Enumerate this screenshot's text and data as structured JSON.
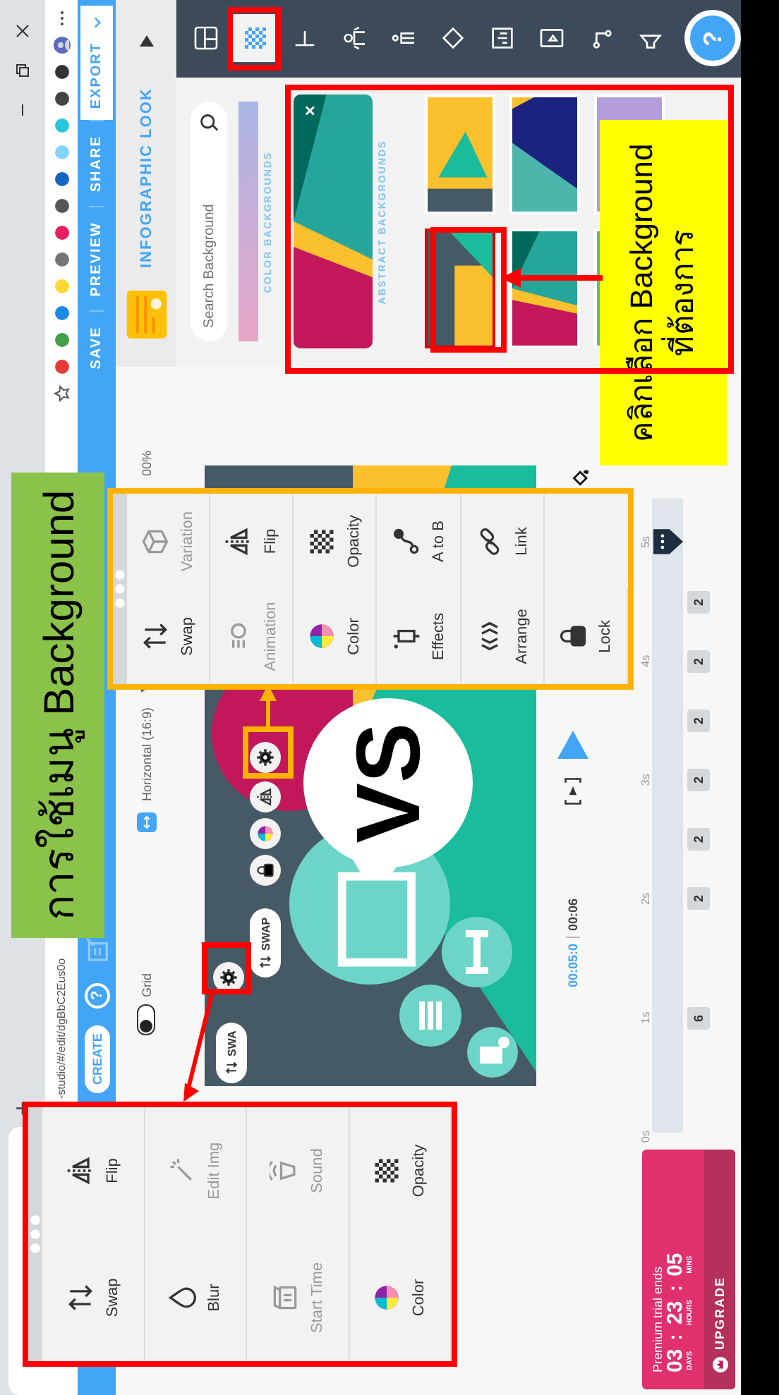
{
  "browser": {
    "new_tab": "+",
    "url": "-studio/#/edit/dgBbC2Eus0o"
  },
  "app_bar": {
    "create": "CREATE",
    "help": "?",
    "actions": [
      {
        "label": "SAVE",
        "kind": "link"
      },
      {
        "label": "PREVIEW",
        "kind": "link"
      },
      {
        "label": "SHARE",
        "kind": "link"
      },
      {
        "label": "EXPORT",
        "kind": "primary"
      }
    ]
  },
  "editor_header": {
    "grid": {
      "label": "Grid",
      "on": false
    },
    "format": "Horizontal (16:9)",
    "zoom": "00%",
    "look": "INFOGRAPHIC LOOK"
  },
  "tool_bar": {
    "help": "?",
    "items": [
      {
        "kind": "layout",
        "selected": false
      },
      {
        "kind": "background",
        "selected": true
      },
      {
        "kind": "text",
        "selected": false
      },
      {
        "kind": "character",
        "selected": false
      },
      {
        "kind": "figure",
        "selected": false
      },
      {
        "kind": "shape",
        "selected": false
      },
      {
        "kind": "chart",
        "selected": false
      },
      {
        "kind": "video",
        "selected": false
      },
      {
        "kind": "connector",
        "selected": false
      },
      {
        "kind": "audio",
        "selected": false
      }
    ]
  },
  "background_panel": {
    "search": {
      "placeholder": "Search Background"
    },
    "color_label": "COLOR BACKGROUNDS",
    "current": {
      "close": "×",
      "kind": "diagonal"
    },
    "abstract_label": "ABSTRACT BACKGROUNDS",
    "tiles": [
      {
        "kind": "wedge",
        "selected": true
      },
      {
        "kind": "triangle",
        "selected": false
      },
      {
        "kind": "diagonal",
        "selected": false
      },
      {
        "kind": "navy",
        "selected": false
      },
      {
        "kind": "mint",
        "selected": false
      },
      {
        "kind": "purple",
        "selected": false
      }
    ]
  },
  "canvas": {
    "headline": "VS",
    "buttons": [
      {
        "kind": "swap",
        "label": "SWA"
      },
      {
        "kind": "gear"
      },
      {
        "kind": "swap",
        "label": "SWAP"
      },
      {
        "kind": "lock"
      },
      {
        "kind": "color"
      },
      {
        "kind": "flip"
      },
      {
        "kind": "gear"
      }
    ]
  },
  "element_menu": {
    "items": [
      {
        "kind": "swap",
        "label": "Swap",
        "disabled": false
      },
      {
        "kind": "variation",
        "label": "Variation",
        "disabled": true
      },
      {
        "kind": "animation",
        "label": "Animation",
        "disabled": true
      },
      {
        "kind": "flip",
        "label": "Flip",
        "disabled": false
      },
      {
        "kind": "color",
        "label": "Color",
        "disabled": false
      },
      {
        "kind": "opacity",
        "label": "Opacity",
        "disabled": false
      },
      {
        "kind": "effects",
        "label": "Effects",
        "disabled": false
      },
      {
        "kind": "path",
        "label": "A to B",
        "disabled": false
      },
      {
        "kind": "arrange",
        "label": "Arrange",
        "disabled": false
      },
      {
        "kind": "link",
        "label": "Link",
        "disabled": false
      },
      {
        "kind": "lock",
        "label": "Lock",
        "disabled": false
      }
    ]
  },
  "background_menu": {
    "items": [
      {
        "kind": "swap",
        "label": "Swap",
        "disabled": false
      },
      {
        "kind": "flip",
        "label": "Flip",
        "disabled": false
      },
      {
        "kind": "blur",
        "label": "Blur",
        "disabled": false
      },
      {
        "kind": "editimg",
        "label": "Edit Img",
        "disabled": true
      },
      {
        "kind": "starttime",
        "label": "Start Time",
        "disabled": true
      },
      {
        "kind": "sound",
        "label": "Sound",
        "disabled": true
      },
      {
        "kind": "color",
        "label": "Color",
        "disabled": false
      },
      {
        "kind": "opacity",
        "label": "Opacity",
        "disabled": false
      }
    ]
  },
  "timeline": {
    "current": "00:05:0",
    "total": "00:06",
    "ticks": [
      "0s",
      "1s",
      "2s",
      "3s",
      "4s",
      "5s"
    ],
    "markers": [
      "6",
      "2",
      "2",
      "2",
      "2",
      "2",
      "2"
    ]
  },
  "trial": {
    "title": "Premium trial ends",
    "separator": ":",
    "units": [
      {
        "value": "03",
        "label": "DAYS"
      },
      {
        "value": "23",
        "label": "HOURS"
      },
      {
        "value": "05",
        "label": "MINS"
      }
    ],
    "button": "UPGRADE"
  },
  "annotations": {
    "title": "การใช้เมนู Background",
    "note_lines": [
      "คลิกเลือก Background",
      "ที่ต้องการ"
    ]
  }
}
